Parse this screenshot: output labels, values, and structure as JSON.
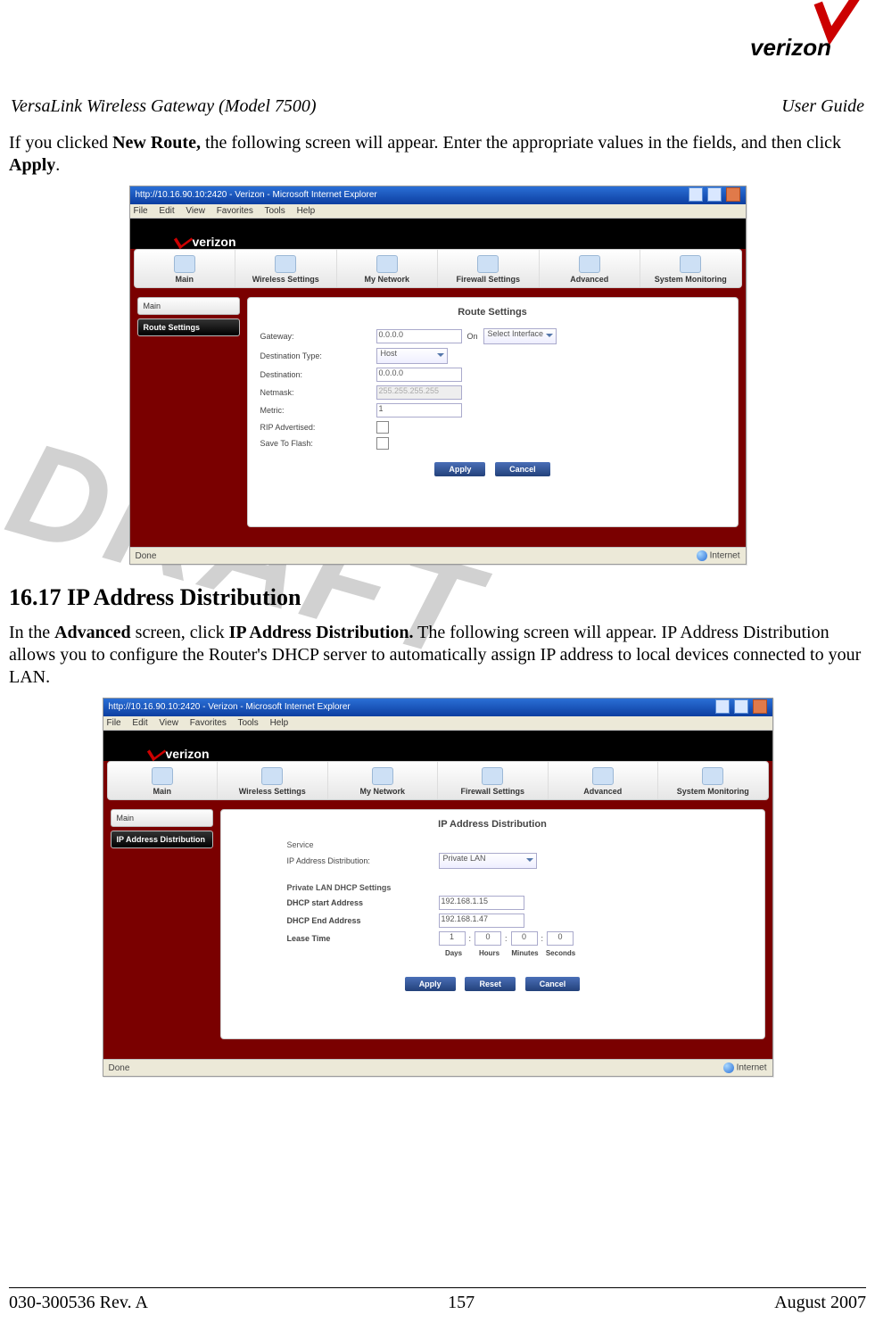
{
  "pageHeader": {
    "left": "VersaLink Wireless Gateway (Model 7500)",
    "right": "User Guide",
    "logoText": "verizon"
  },
  "watermark": "DRAFT",
  "intro1": {
    "pre": "If you clicked ",
    "bold1": "New Route,",
    "mid": " the following screen will appear. Enter the appropriate values in the fields, and then click ",
    "bold2": "Apply",
    "post": "."
  },
  "sectionHeading": "16.17   IP Address Distribution",
  "intro2": {
    "pre": "In the ",
    "bold1": "Advanced",
    "mid1": " screen, click ",
    "bold2": "IP Address Distribution.",
    "post": " The following screen will appear. IP Address Distribution allows you to configure the Router's DHCP server to automatically assign IP address to local devices connected to your LAN."
  },
  "ie": {
    "title": "http://10.16.90.10:2420 - Verizon - Microsoft Internet Explorer",
    "menus": [
      "File",
      "Edit",
      "View",
      "Favorites",
      "Tools",
      "Help"
    ],
    "statusLeft": "Done",
    "statusRight": "Internet"
  },
  "router": {
    "brand": "verizon",
    "tabs": [
      "Main",
      "Wireless Settings",
      "My Network",
      "Firewall Settings",
      "Advanced",
      "System Monitoring"
    ]
  },
  "screen1": {
    "sidebar": [
      "Main",
      "Route Settings"
    ],
    "panelTitle": "Route Settings",
    "rows": {
      "gateway": {
        "label": "Gateway:",
        "value": "0.0.0.0",
        "on": "On",
        "select": "Select Interface"
      },
      "destType": {
        "label": "Destination Type:",
        "value": "Host"
      },
      "destination": {
        "label": "Destination:",
        "value": "0.0.0.0"
      },
      "netmask": {
        "label": "Netmask:",
        "value": "255.255.255.255"
      },
      "metric": {
        "label": "Metric:",
        "value": "1"
      },
      "rip": {
        "label": "RIP Advertised:"
      },
      "save": {
        "label": "Save To Flash:"
      }
    },
    "buttons": [
      "Apply",
      "Cancel"
    ]
  },
  "screen2": {
    "sidebar": [
      "Main",
      "IP Address Distribution"
    ],
    "panelTitle": "IP Address Distribution",
    "serviceHead": "Service",
    "serviceRow": {
      "label": "IP Address Distribution:",
      "value": "Private LAN"
    },
    "dhcpHead": "Private LAN DHCP Settings",
    "startRow": {
      "label": "DHCP start Address",
      "value": "192.168.1.15"
    },
    "endRow": {
      "label": "DHCP End Address",
      "value": "192.168.1.47"
    },
    "leaseRow": {
      "label": "Lease Time",
      "d": "1",
      "h": "0",
      "m": "0",
      "s": "0"
    },
    "leaseLabels": [
      "Days",
      "Hours",
      "Minutes",
      "Seconds"
    ],
    "buttons": [
      "Apply",
      "Reset",
      "Cancel"
    ]
  },
  "footer": {
    "left": "030-300536 Rev. A",
    "center": "157",
    "right": "August 2007"
  }
}
